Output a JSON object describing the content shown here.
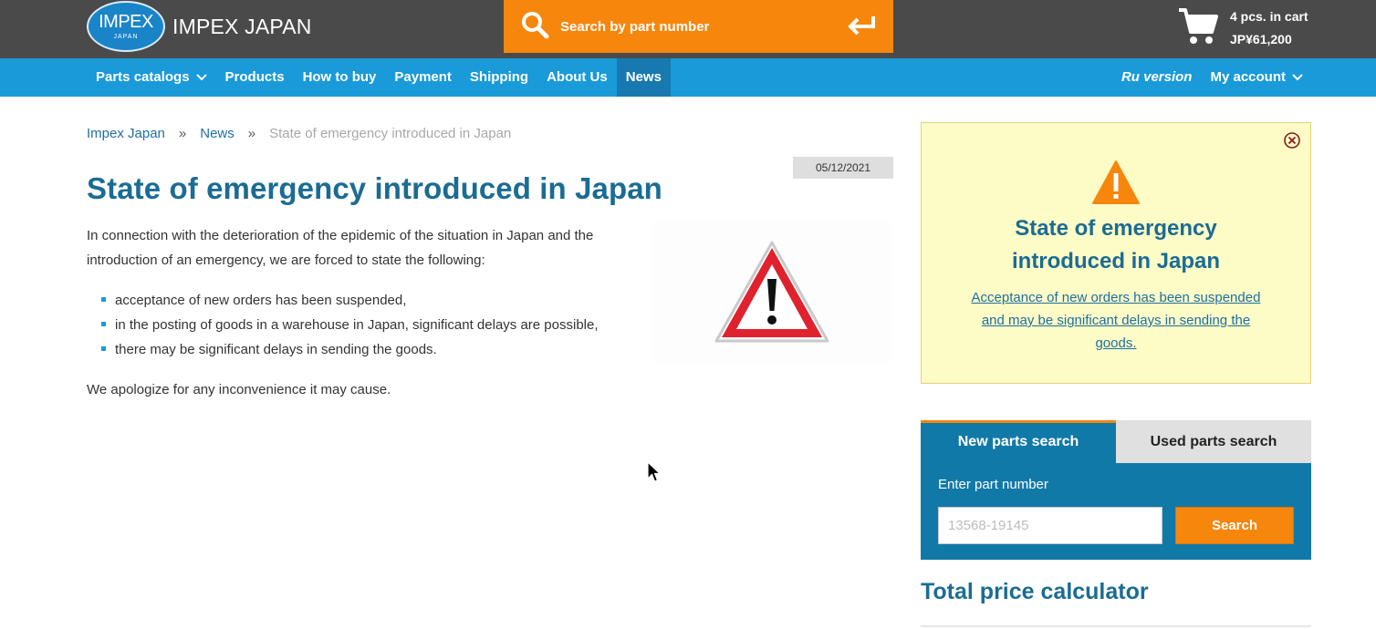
{
  "header": {
    "logo_big": "IMPEX",
    "logo_small": "JAPAN",
    "brand": "IMPEX JAPAN",
    "search_placeholder": "Search by part number",
    "cart_count": "4 pcs. in cart",
    "cart_total": "JP¥61,200"
  },
  "nav": {
    "items": [
      {
        "label": "Parts catalogs",
        "has_dropdown": true
      },
      {
        "label": "Products"
      },
      {
        "label": "How to buy"
      },
      {
        "label": "Payment"
      },
      {
        "label": "Shipping"
      },
      {
        "label": "About Us"
      },
      {
        "label": "News",
        "active": true
      }
    ],
    "ru_version": "Ru version",
    "my_account": "My account"
  },
  "breadcrumb": {
    "home": "Impex Japan",
    "separator": "»",
    "section": "News",
    "current": "State of emergency introduced in Japan"
  },
  "article": {
    "date": "05/12/2021",
    "title": "State of emergency introduced in Japan",
    "intro": "In connection with the deterioration of the epidemic of the situation in Japan and the introduction of an emergency, we are forced to state the following:",
    "bullets": [
      "acceptance of new orders has been suspended,",
      "in the posting of goods in a warehouse in Japan, significant delays are possible,",
      "there may be significant delays in sending the goods."
    ],
    "closing": "We apologize for any inconvenience it may cause."
  },
  "alert": {
    "title": "State of emergency introduced in Japan",
    "link": "Acceptance of new orders has been suspended and may be significant delays in sending the goods."
  },
  "parts_search": {
    "tab_new": "New parts search",
    "tab_used": "Used parts search",
    "label": "Enter part number",
    "placeholder": "13568-19145",
    "button": "Search"
  },
  "calculator": {
    "title": "Total price calculator"
  },
  "colors": {
    "topbar": "#4a4a4a",
    "accent_orange": "#f7860d",
    "nav_blue": "#1a9ad9",
    "title_blue": "#1b6c93",
    "alert_bg": "#fdfbc6"
  }
}
